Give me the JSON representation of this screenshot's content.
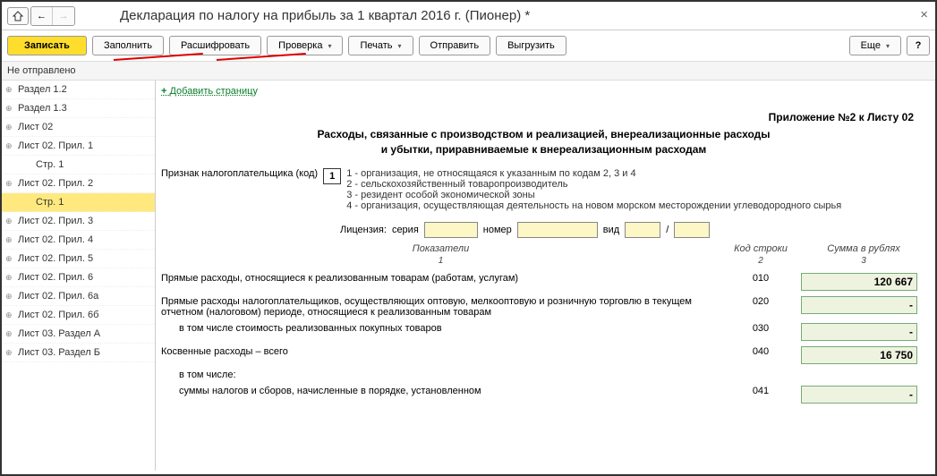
{
  "window": {
    "title": "Декларация по налогу на прибыль за 1 квартал 2016 г. (Пионер) *"
  },
  "toolbar": {
    "save": "Записать",
    "fill": "Заполнить",
    "decrypt": "Расшифровать",
    "check": "Проверка",
    "print": "Печать",
    "send": "Отправить",
    "export": "Выгрузить",
    "more": "Еще",
    "help": "?"
  },
  "status": "Не отправлено",
  "sidebar": {
    "items": [
      {
        "label": "Раздел 1.2",
        "child": false
      },
      {
        "label": "Раздел 1.3",
        "child": false
      },
      {
        "label": "Лист 02",
        "child": false
      },
      {
        "label": "Лист 02. Прил. 1",
        "child": false
      },
      {
        "label": "Стр. 1",
        "child": true
      },
      {
        "label": "Лист 02. Прил. 2",
        "child": false
      },
      {
        "label": "Стр. 1",
        "child": true,
        "selected": true
      },
      {
        "label": "Лист 02. Прил. 3",
        "child": false
      },
      {
        "label": "Лист 02. Прил. 4",
        "child": false
      },
      {
        "label": "Лист 02. Прил. 5",
        "child": false
      },
      {
        "label": "Лист 02. Прил. 6",
        "child": false
      },
      {
        "label": "Лист 02. Прил. 6а",
        "child": false
      },
      {
        "label": "Лист 02. Прил. 6б",
        "child": false
      },
      {
        "label": "Лист 03. Раздел А",
        "child": false
      },
      {
        "label": "Лист 03. Раздел Б",
        "child": false
      }
    ]
  },
  "content": {
    "add_page": "Добавить страницу",
    "appendix_header": "Приложение №2 к Листу 02",
    "title_line1": "Расходы, связанные с производством и реализацией, внереализационные расходы",
    "title_line2": "и убытки, приравниваемые к внереализационным расходам",
    "taxpayer_sign_label": "Признак налогоплательщика (код)",
    "taxpayer_sign_code": "1",
    "code_notes": [
      "1 - организация, не относящаяся к указанным по кодам 2, 3 и 4",
      "2 - сельскохозяйственный товаропроизводитель",
      "3 - резидент особой экономической зоны",
      "4 - организация, осуществляющая деятельность на новом морском месторождении углеводородного сырья"
    ],
    "license": {
      "label": "Лицензия:",
      "series": "серия",
      "number": "номер",
      "type": "вид",
      "sep": "/"
    },
    "columns": {
      "c1": "Показатели",
      "c2": "Код строки",
      "c3": "Сумма в рублях",
      "n1": "1",
      "n2": "2",
      "n3": "3"
    },
    "rows": [
      {
        "label": "Прямые расходы, относящиеся к реализованным товарам (работам, услугам)",
        "code": "010",
        "value": "120 667"
      },
      {
        "label": "Прямые расходы налогоплательщиков, осуществляющих оптовую, мелкооптовую и розничную торговлю в текущем отчетном (налоговом) периоде, относящиеся к реализованным товарам",
        "code": "020",
        "value": "-"
      },
      {
        "label": "в том числе стоимость реализованных покупных товаров",
        "code": "030",
        "value": "-",
        "sub": true
      },
      {
        "label": "Косвенные расходы – всего",
        "code": "040",
        "value": "16 750"
      },
      {
        "label": "в том числе:",
        "code": "",
        "value": "",
        "sub": true,
        "novalue": true
      },
      {
        "label": "суммы налогов и сборов, начисленные в порядке, установленном",
        "code": "041",
        "value": "-",
        "sub": true
      }
    ]
  }
}
